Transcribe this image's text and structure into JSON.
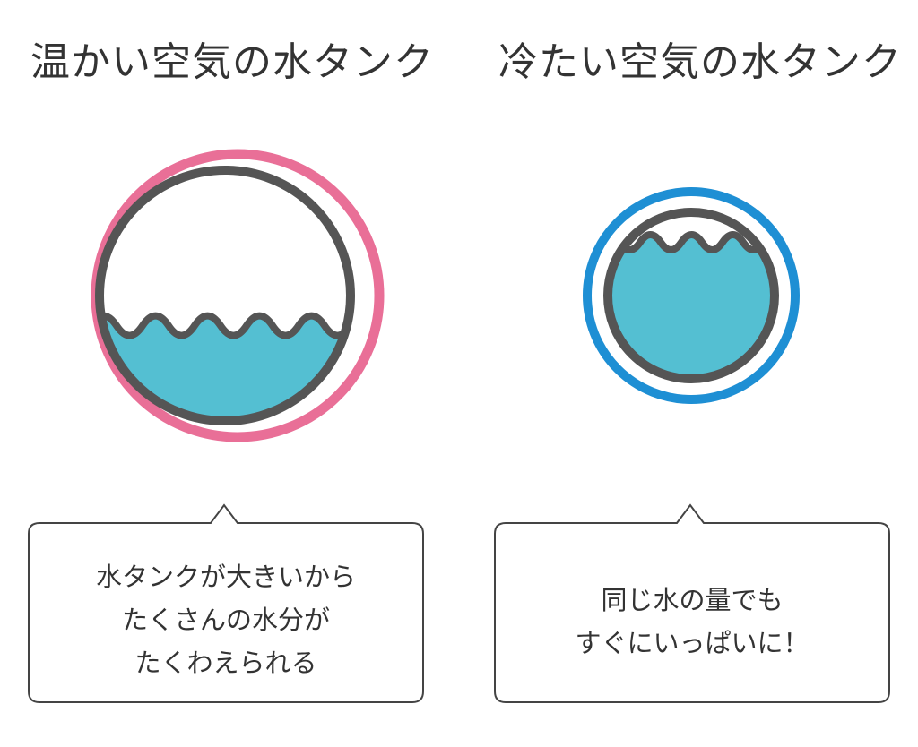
{
  "colors": {
    "warm_ring": "#e96f97",
    "cold_ring": "#1e8fd4",
    "tank_outline": "#555555",
    "water": "#54bfd2",
    "bubble_border": "#444444",
    "text": "#333333"
  },
  "warm": {
    "title": "温かい空気の水タンク",
    "water_fill_fraction": 0.38,
    "description": [
      "水タンクが大きいから",
      "たくさんの水分が",
      "たくわえられる"
    ]
  },
  "cold": {
    "title": "冷たい空気の水タンク",
    "water_fill_fraction": 0.82,
    "description": [
      "同じ水の量でも",
      "すぐにいっぱいに！"
    ]
  }
}
